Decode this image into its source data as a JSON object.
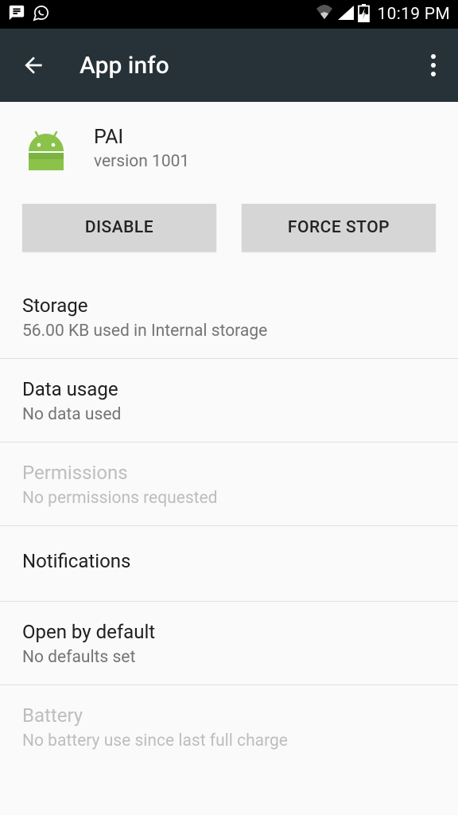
{
  "status_bar": {
    "time": "10:19 PM"
  },
  "app_bar": {
    "title": "App info"
  },
  "app": {
    "name": "PAI",
    "version": "version 1001"
  },
  "buttons": {
    "disable": "DISABLE",
    "force_stop": "FORCE STOP"
  },
  "items": {
    "storage": {
      "title": "Storage",
      "subtitle": "56.00 KB used in Internal storage"
    },
    "data_usage": {
      "title": "Data usage",
      "subtitle": "No data used"
    },
    "permissions": {
      "title": "Permissions",
      "subtitle": "No permissions requested"
    },
    "notifications": {
      "title": "Notifications"
    },
    "open_default": {
      "title": "Open by default",
      "subtitle": "No defaults set"
    },
    "battery": {
      "title": "Battery",
      "subtitle": "No battery use since last full charge"
    }
  }
}
